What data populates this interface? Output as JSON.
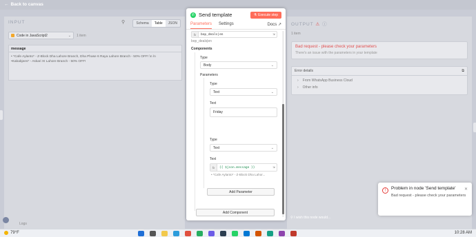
{
  "topbar": {
    "back_label": "Back to canvas"
  },
  "input_panel": {
    "title": "INPUT",
    "view_tabs": [
      "Schema",
      "Table",
      "JSON"
    ],
    "active_view": "Table",
    "source_node": "Code in JavaScript2",
    "item_count": "1 item",
    "column_header": "message",
    "cell_line1": "• *Cafe Aylanto* - Z-Block Dha Lahore Branch, Dha Phase 6 Raya Lahore Branch - 50% OFF! \\n \\n",
    "cell_line2": "•Kababjees* - Askari XI Lahore Branch - 50% OFF!"
  },
  "modal": {
    "title": "Send template",
    "execute_label": "Execute step",
    "tabs": [
      "Parameters",
      "Settings"
    ],
    "active_tab": "Parameters",
    "docs_label": "Docs",
    "template_expr": "bop_deals|en",
    "template_value": "bop_deals|en",
    "components_label": "Components",
    "type_label": "Type",
    "type_value": "Body",
    "parameters_label": "Parameters",
    "param1_type_label": "Type",
    "param1_type_value": "Text",
    "param1_text_label": "Text",
    "param1_text_value": "Friday",
    "param2_type_label": "Type",
    "param2_type_value": "Text",
    "param2_text_label": "Text",
    "param2_expr": "{{ $json.message }}",
    "param2_preview": "• *Cafe Aylanto* - Z-Block Dha Lahor...",
    "add_parameter_label": "Add Parameter",
    "add_component_label": "Add Component"
  },
  "output_panel": {
    "title": "OUTPUT",
    "item_count": "1 item",
    "error_title": "Bad request - please check your parameters",
    "error_sub": "There's an issue with the parameters in your template",
    "details_label": "Error details",
    "detail_rows": [
      "From WhatsApp Business Cloud",
      "Other info"
    ]
  },
  "wish_text": "I wish this node would...",
  "logs_label": "Logs",
  "toast": {
    "title": "Problem in node 'Send template'",
    "message": "Bad request - please check your parameters"
  },
  "taskbar": {
    "temperature": "79°F",
    "time": "10:28 AM"
  },
  "colors": {
    "accent": "#ff6d5a",
    "error": "#e05050",
    "whatsapp": "#25d366"
  }
}
